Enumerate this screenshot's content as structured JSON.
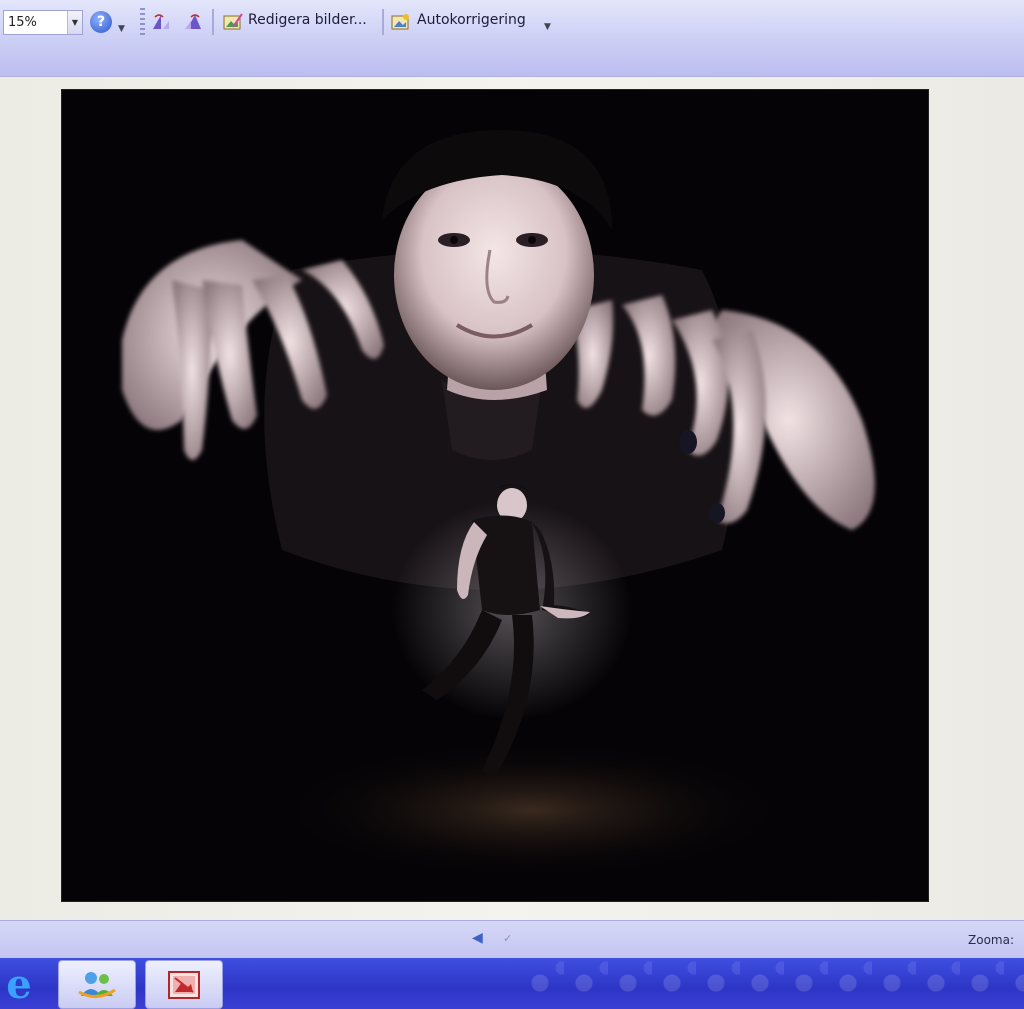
{
  "toolbar": {
    "zoom_value": "15%",
    "help_glyph": "?",
    "edit_pictures_label": "Redigera bilder...",
    "autocorrect_label": "Autokorrigering",
    "icons": [
      "help-icon",
      "rotate-left-icon",
      "rotate-right-icon",
      "edit-pictures-icon",
      "autocorrect-icon"
    ]
  },
  "statusbar": {
    "zoom_label": "Zooma:",
    "prev_glyph": "◀",
    "next_glyph": "✓"
  },
  "taskbar": {
    "items": [
      "internet-explorer-icon",
      "windows-live-messenger-icon",
      "picture-manager-icon"
    ]
  },
  "colors": {
    "toolbar_bg": "#cfd2f6",
    "taskbar_bg": "#2d35c6",
    "photo_bg": "#050306"
  }
}
